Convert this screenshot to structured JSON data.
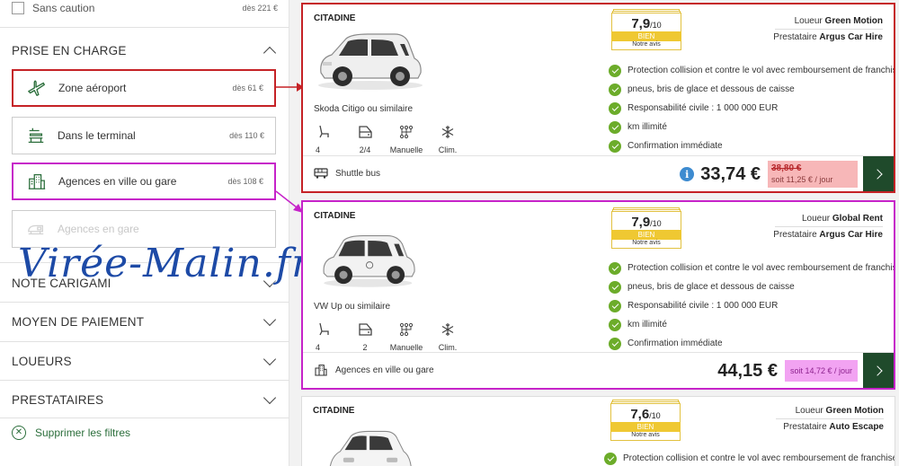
{
  "sidebar": {
    "deposit": {
      "label": "Sans caution",
      "price": "dès 221 €"
    },
    "pickup_section": {
      "title": "PRISE EN CHARGE"
    },
    "pickup_options": [
      {
        "label": "Zone aéroport",
        "price": "dès 61 €",
        "icon": "airplane-icon"
      },
      {
        "label": "Dans le terminal",
        "price": "dès 110 €",
        "icon": "terminal-desk-icon"
      },
      {
        "label": "Agences en ville ou gare",
        "price": "dès 108 €",
        "icon": "city-building-icon"
      },
      {
        "label": "Agences en gare",
        "price": "",
        "icon": "train-icon"
      }
    ],
    "sections": [
      {
        "title": "NOTE CARIGAMI"
      },
      {
        "title": "MOYEN DE PAIEMENT"
      },
      {
        "title": "LOUEURS"
      },
      {
        "title": "PRESTATAIRES"
      }
    ],
    "clear_filters": "Supprimer les filtres",
    "watermark": "Virée-Malin.fr"
  },
  "highlight_colors": {
    "airport": "#c52226",
    "city": "#c623c9",
    "rating": "#efc832",
    "check": "#6cac2a",
    "go_button": "#1f4a2b"
  },
  "results": [
    {
      "category": "CITADINE",
      "model": "Skoda Citigo ou similaire",
      "specs": {
        "seats": "4",
        "doors": "2/4",
        "gearbox": "Manuelle",
        "ac": "Clim."
      },
      "rating": {
        "score": "7,9",
        "out_of": "/10",
        "label": "BIEN",
        "sub": "Notre avis"
      },
      "renter_label": "Loueur",
      "renter": "Green Motion",
      "provider_label": "Prestataire",
      "provider": "Argus Car Hire",
      "features": [
        "Protection collision et contre le vol avec remboursement de franchise",
        "pneus, bris de glace et dessous de caisse",
        "Responsabilité civile : 1 000 000 EUR",
        "km illimité",
        "Confirmation immédiate"
      ],
      "pickup": "Shuttle bus",
      "price": "33,74 €",
      "old_price": "38,80 €",
      "per_day": "soit 11,25 € / jour"
    },
    {
      "category": "CITADINE",
      "model": "VW Up ou similaire",
      "specs": {
        "seats": "4",
        "doors": "2",
        "gearbox": "Manuelle",
        "ac": "Clim."
      },
      "rating": {
        "score": "7,9",
        "out_of": "/10",
        "label": "BIEN",
        "sub": "Notre avis"
      },
      "renter_label": "Loueur",
      "renter": "Global Rent",
      "provider_label": "Prestataire",
      "provider": "Argus Car Hire",
      "features": [
        "Protection collision et contre le vol avec remboursement de franchise",
        "pneus, bris de glace et dessous de caisse",
        "Responsabilité civile : 1 000 000 EUR",
        "km illimité",
        "Confirmation immédiate"
      ],
      "pickup": "Agences en ville ou gare",
      "price": "44,15 €",
      "per_day": "soit 14,72 € / jour"
    },
    {
      "category": "CITADINE",
      "rating": {
        "score": "7,6",
        "out_of": "/10",
        "label": "BIEN",
        "sub": "Notre avis"
      },
      "renter_label": "Loueur",
      "renter": "Green Motion",
      "provider_label": "Prestataire",
      "provider": "Auto Escape",
      "features": [
        "Protection collision et contre le vol avec remboursement de franchise"
      ]
    }
  ]
}
